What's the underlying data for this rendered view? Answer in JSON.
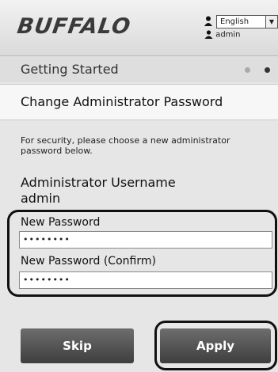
{
  "header": {
    "logo": "BUFFALO",
    "language_selected": "English",
    "user": "admin"
  },
  "progress": {
    "title": "Getting Started",
    "steps_total": 2,
    "current_step": 2
  },
  "section": {
    "title": "Change Administrator Password",
    "intro": "For security, please choose a new administrator password below."
  },
  "form": {
    "username_label": "Administrator Username",
    "username_value": "admin",
    "new_password_label": "New Password",
    "new_password_value": "••••••••",
    "confirm_password_label": "New Password (Confirm)",
    "confirm_password_value": "••••••••"
  },
  "buttons": {
    "skip": "Skip",
    "apply": "Apply"
  },
  "colors": {
    "button": "#4a4a4a",
    "highlight": "#111111"
  }
}
